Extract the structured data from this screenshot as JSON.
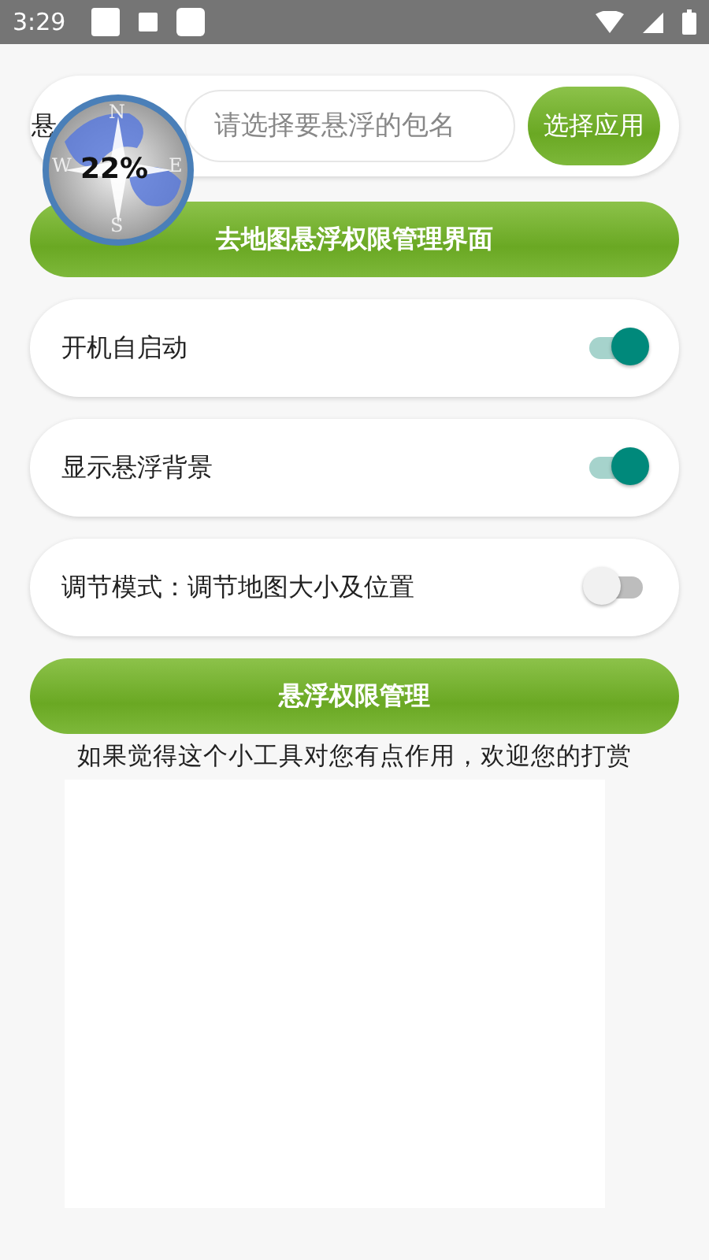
{
  "status_bar": {
    "time": "3:29"
  },
  "package_row": {
    "label": "悬",
    "placeholder": "请选择要悬浮的包名",
    "button": "选择应用"
  },
  "compass": {
    "directions": [
      "N",
      "E",
      "S",
      "W"
    ],
    "percent": "22%"
  },
  "map_permission_button": "去地图悬浮权限管理界面",
  "settings": [
    {
      "label": "开机自启动",
      "on": true
    },
    {
      "label": "显示悬浮背景",
      "on": true
    },
    {
      "label": "调节模式：调节地图大小及位置",
      "on": false
    }
  ],
  "permission_button": "悬浮权限管理",
  "donate_text": "如果觉得这个小工具对您有点作用，欢迎您的打赏"
}
